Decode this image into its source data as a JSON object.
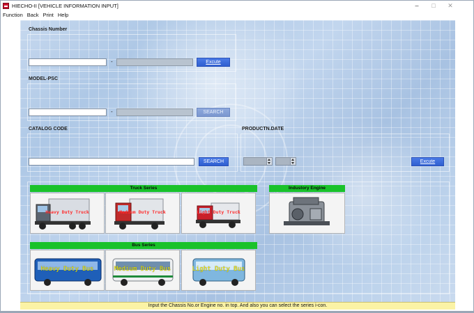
{
  "window": {
    "title": "HIECHO-II [VEHICLE INFORMATION INPUT]",
    "minimize": "–",
    "maximize": "□",
    "close": "✕"
  },
  "menu": [
    "Function",
    "Back",
    "Print",
    "Help"
  ],
  "chassis": {
    "label": "Chassis Number",
    "input1": "",
    "dash": "-",
    "input2": "",
    "button": "Excute"
  },
  "model": {
    "label": "MODEL-PSC",
    "input1": "",
    "dash": "-",
    "input2": "",
    "button": "SEARCH"
  },
  "catalog": {
    "label": "CATALOG CODE",
    "input": "",
    "button": "SEARCH"
  },
  "production": {
    "label": "PRODUCTN.DATE",
    "year": "",
    "month": "",
    "button": "Excute"
  },
  "truck_series": {
    "header": "Truck Series",
    "tiles": [
      {
        "label": "Heavy Duty Truck"
      },
      {
        "label": "Medium Duty Truck"
      },
      {
        "label": "Light Duty Truck"
      }
    ]
  },
  "industory_engine": {
    "header": "Industory Engine"
  },
  "bus_series": {
    "header": "Bus Series",
    "tiles": [
      {
        "label": "Heavy Duty Bus"
      },
      {
        "label": "Medium Duty Bus"
      },
      {
        "label": "Light Duty Bus"
      }
    ]
  },
  "status": "Input the Chassis No.or Engine no. in top. And also you can select the series i-con.",
  "colors": {
    "series_header": "#19c22a",
    "button": "#2f5fd0",
    "status_bg": "#fbf3a5",
    "truck_label": "#ff2a2a",
    "bus_label": "#f4f000"
  }
}
